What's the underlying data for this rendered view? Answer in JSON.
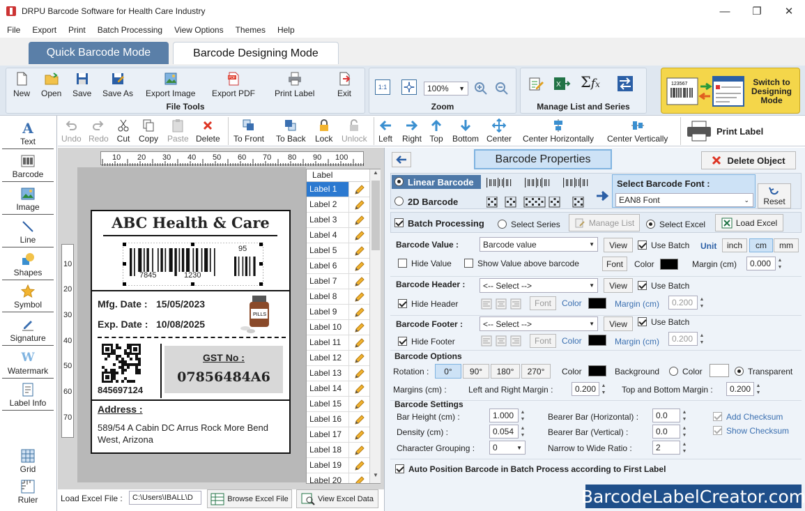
{
  "window": {
    "title": "DRPU Barcode Software for Health Care Industry"
  },
  "menu": [
    "File",
    "Export",
    "Print",
    "Batch Processing",
    "View Options",
    "Themes",
    "Help"
  ],
  "modes": {
    "quick": "Quick Barcode Mode",
    "designing": "Barcode Designing Mode"
  },
  "file_tools": {
    "caption": "File Tools",
    "buttons": [
      "New",
      "Open",
      "Save",
      "Save As",
      "Export Image",
      "Export PDF",
      "Print Label",
      "Exit"
    ]
  },
  "zoom": {
    "caption": "Zoom",
    "value": "100%"
  },
  "manage": {
    "caption": "Manage List and Series"
  },
  "switch_btn": "Switch to Designing Mode",
  "left_tools": [
    "Text",
    "Barcode",
    "Image",
    "Line",
    "Shapes",
    "Symbol",
    "Signature",
    "Watermark",
    "Label Info",
    "Grid",
    "Ruler"
  ],
  "edit_tools": [
    "Undo",
    "Redo",
    "Cut",
    "Copy",
    "Paste",
    "Delete",
    "To Front",
    "To Back",
    "Lock",
    "Unlock",
    "Left",
    "Right",
    "Top",
    "Bottom",
    "Center",
    "Center Horizontally",
    "Center Vertically"
  ],
  "print_label": "Print Label",
  "ruler": {
    "top": [
      "10",
      "20",
      "30",
      "40",
      "50",
      "60",
      "70",
      "80",
      "90",
      "100"
    ],
    "left": [
      "10",
      "20",
      "30",
      "40",
      "50",
      "60",
      "70"
    ]
  },
  "label_card": {
    "company": "ABC Health & Care",
    "barcode_digits": {
      "left": "7845",
      "right": "1230",
      "addon": "95"
    },
    "mfg_label": "Mfg. Date :",
    "mfg_value": "15/05/2023",
    "exp_label": "Exp. Date :",
    "exp_value": "10/08/2025",
    "pills_text": "PILLS",
    "qr_number": "845697124",
    "gst_label": "GST No :",
    "gst_value": "07856484A6",
    "address_label": "Address :",
    "address_line1": "589/54 A Cabin DC Arrus Rock More Bend",
    "address_line2": "West, Arizona"
  },
  "labels_list": {
    "header": "Label",
    "items": [
      "Label 1",
      "Label 2",
      "Label 3",
      "Label 4",
      "Label 5",
      "Label 6",
      "Label 7",
      "Label 8",
      "Label 9",
      "Label 10",
      "Label 11",
      "Label 12",
      "Label 13",
      "Label 14",
      "Label 15",
      "Label 16",
      "Label 17",
      "Label 18",
      "Label 19",
      "Label 20"
    ],
    "selected": 0
  },
  "load_excel": {
    "label": "Load Excel File :",
    "path": "C:\\Users\\IBALL\\D",
    "browse": "Browse Excel File",
    "view": "View Excel Data"
  },
  "props": {
    "title": "Barcode Properties",
    "delete_object": "Delete Object",
    "linear": "Linear Barcode",
    "twod": "2D Barcode",
    "font_caption": "Select Barcode Font :",
    "font_value": "EAN8 Font",
    "reset": "Reset",
    "batch_processing": "Batch Processing",
    "select_series": "Select Series",
    "manage_list": "Manage List",
    "select_excel": "Select Excel",
    "load_excel": "Load Excel",
    "barcode_value_lbl": "Barcode Value :",
    "barcode_value": "Barcode value",
    "view": "View",
    "use_batch": "Use Batch",
    "unit": "Unit",
    "units": [
      "inch",
      "cm",
      "mm"
    ],
    "hide_value": "Hide Value",
    "show_value_above": "Show Value above barcode",
    "font": "Font",
    "color": "Color",
    "margin_cm": "Margin (cm)",
    "margin_value": "0.000",
    "header_lbl": "Barcode Header :",
    "select_placeholder": "<-- Select -->",
    "hide_header": "Hide Header",
    "header_margin": "0.200",
    "footer_lbl": "Barcode Footer :",
    "hide_footer": "Hide Footer",
    "footer_margin": "0.200",
    "options_title": "Barcode Options",
    "rotation": "Rotation :",
    "rotations": [
      "0°",
      "90°",
      "180°",
      "270°"
    ],
    "background": "Background",
    "transparent": "Transparent",
    "margins_cm": "Margins (cm) :",
    "lr_margin": "Left and Right Margin :",
    "lr_value": "0.200",
    "tb_margin": "Top and Bottom Margin :",
    "tb_value": "0.200",
    "settings_title": "Barcode Settings",
    "bar_height": "Bar Height (cm) :",
    "bar_height_v": "1.000",
    "density": "Density (cm) :",
    "density_v": "0.054",
    "char_group": "Character Grouping :",
    "char_group_v": "0",
    "bearer_h": "Bearer Bar (Horizontal) :",
    "bearer_h_v": "0.0",
    "bearer_v": "Bearer Bar (Vertical) :",
    "bearer_v_v": "0.0",
    "n2w": "Narrow to Wide Ratio :",
    "n2w_v": "2",
    "add_checksum": "Add Checksum",
    "show_checksum": "Show Checksum",
    "auto_position": "Auto Position Barcode in Batch Process according to First Label"
  },
  "watermark": "BarcodeLabelCreator.com"
}
